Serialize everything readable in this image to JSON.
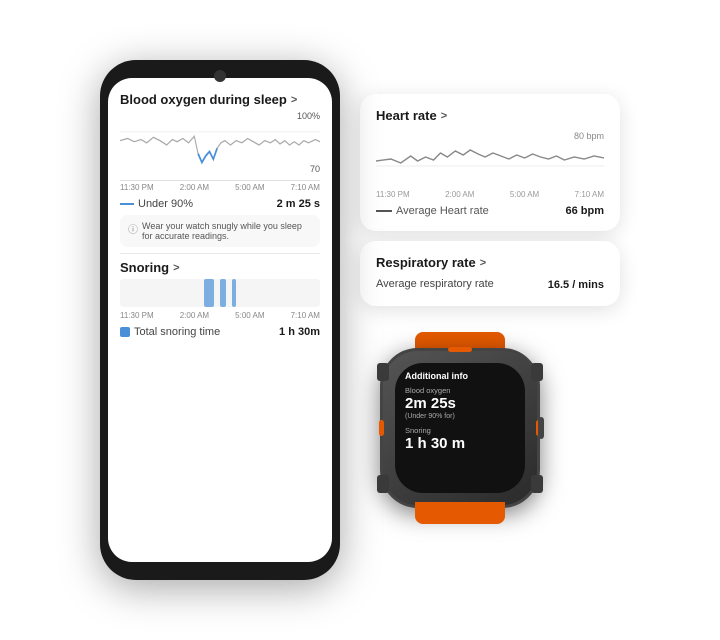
{
  "phone": {
    "blood_oxygen": {
      "title": "Blood oxygen during sleep",
      "chevron": ">",
      "chart_top_label": "100%",
      "chart_bottom_label": "70",
      "times": [
        "11:30 PM",
        "2:00 AM",
        "5:00 AM",
        "7:10 AM"
      ],
      "stat_label": "Under 90%",
      "stat_value": "2 m 25 s",
      "info_text": "Wear your watch snugly while you sleep for accurate readings."
    },
    "snoring": {
      "title": "Snoring",
      "chevron": ">",
      "times": [
        "11:30 PM",
        "2:00 AM",
        "5:00 AM",
        "7:10 AM"
      ],
      "stat_label": "Total snoring time",
      "stat_value": "1 h 30m"
    }
  },
  "card_heart": {
    "title": "Heart rate",
    "chevron": ">",
    "chart_label": "80 bpm",
    "times": [
      "11:30 PM",
      "2:00 AM",
      "5:00 AM",
      "7:10 AM"
    ],
    "stat_label": "Average Heart rate",
    "stat_value": "66 bpm"
  },
  "card_respiratory": {
    "title": "Respiratory rate",
    "chevron": ">",
    "stat_label": "Average respiratory rate",
    "stat_value": "16.5 / mins"
  },
  "watch": {
    "title": "Additional info",
    "blood_oxygen_label": "Blood oxygen",
    "blood_oxygen_value": "2m 25s",
    "blood_oxygen_sub": "(Under 90% for)",
    "snoring_label": "Snoring",
    "snoring_value": "1 h 30 m"
  }
}
